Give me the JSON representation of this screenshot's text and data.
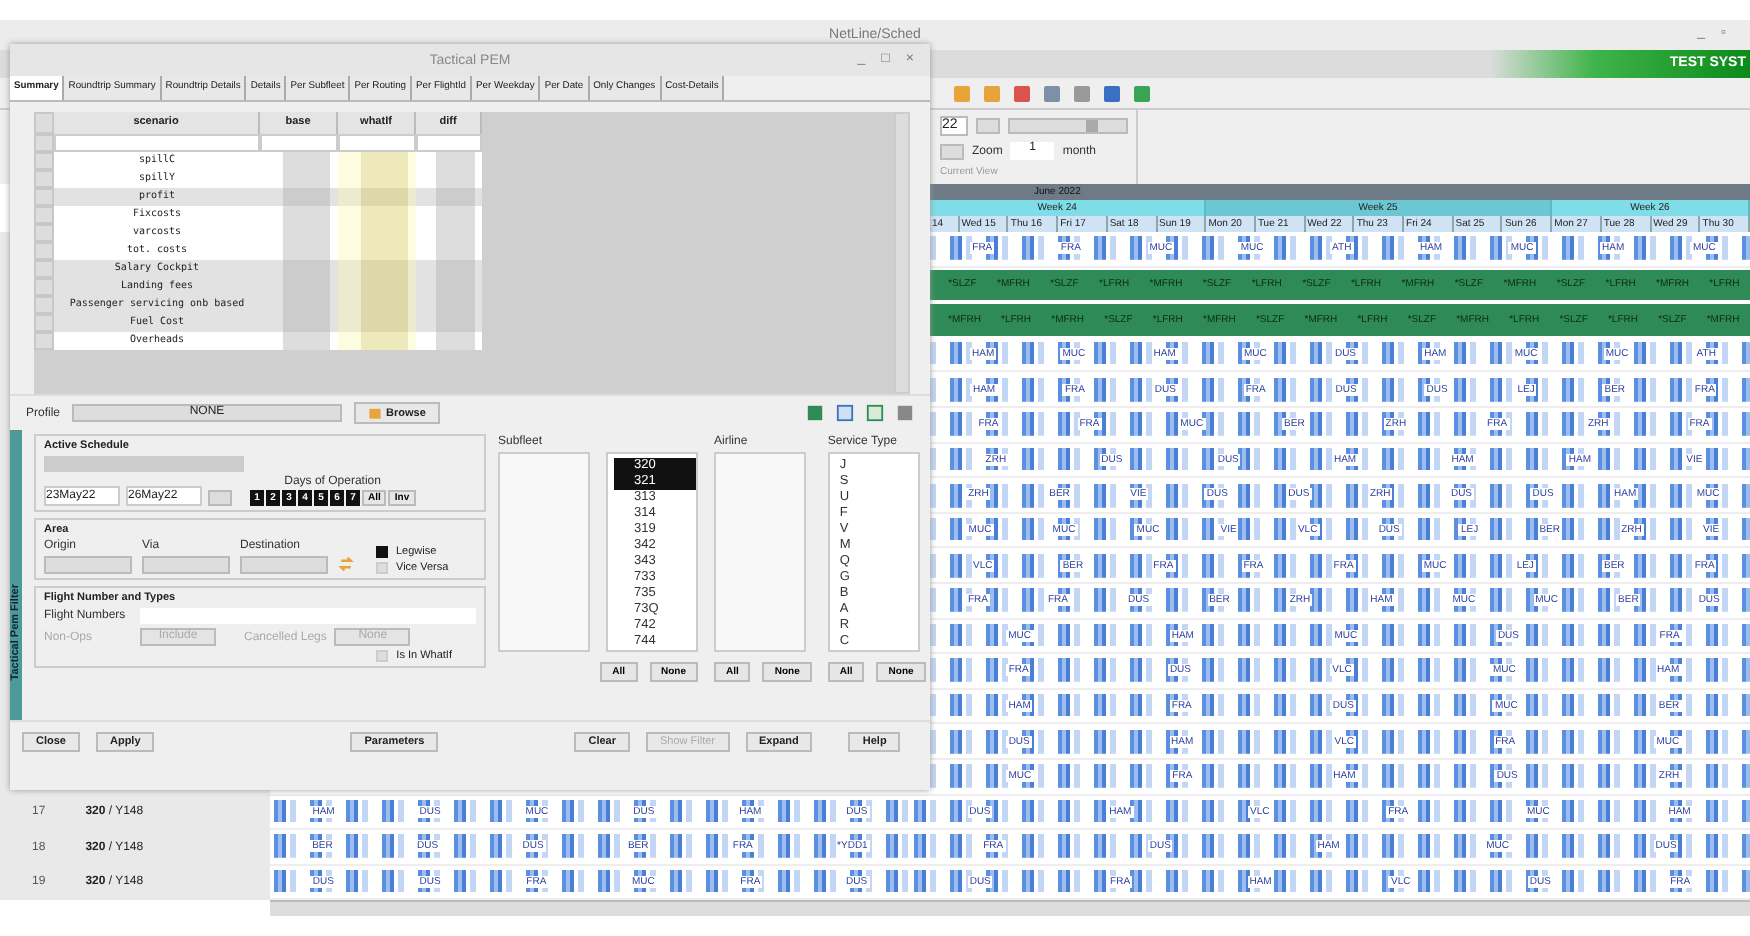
{
  "main_window": {
    "title": "NetLine/Sched",
    "window_buttons": [
      "_",
      "▫"
    ],
    "slider": {
      "level": 0.75
    },
    "banner": "TEST SYST",
    "date_field": "22",
    "zoom_label": "Zoom",
    "zoom_value": "1",
    "zoom_unit": "month",
    "view_label": "Current View"
  },
  "calendar": {
    "month": "June 2022",
    "weeks": [
      {
        "label": "Week 24",
        "days": [
          "14",
          "Wed 15",
          "Thu 16",
          "Fri 17",
          "Sat 18",
          "Sun 19"
        ]
      },
      {
        "label": "Week 25",
        "days": [
          "Mon 20",
          "Tue 21",
          "Wed 22",
          "Thu 23",
          "Fri 24",
          "Sat 25",
          "Sun 26"
        ]
      },
      {
        "label": "Week 26",
        "days": [
          "Mon 27",
          "Tue 28",
          "Wed 29",
          "Thu 30"
        ]
      }
    ]
  },
  "rows": [
    {
      "kind": "flights",
      "labels": [
        "FRA",
        "FRA",
        "MUC",
        "MUC",
        "ATH",
        "HAM",
        "MUC",
        "HAM",
        "MUC"
      ]
    },
    {
      "kind": "block",
      "labels": [
        "*SLZF",
        "*MFRH",
        "*SLZF",
        "*LFRH",
        "*MFRH",
        "*SLZF",
        "*LFRH",
        "*SLZF",
        "*LFRH",
        "*MFRH",
        "*SLZF",
        "*MFRH",
        "*SLZF",
        "*LFRH",
        "*MFRH",
        "*LFRH"
      ]
    },
    {
      "kind": "block",
      "labels": [
        "*MFRH",
        "*LFRH",
        "*MFRH",
        "*SLZF",
        "*LFRH",
        "*MFRH",
        "*SLZF",
        "*MFRH",
        "*LFRH",
        "*SLZF",
        "*MFRH",
        "*LFRH",
        "*SLZF",
        "*LFRH",
        "*SLZF",
        "*MFRH"
      ]
    },
    {
      "kind": "flights",
      "labels": [
        "HAM",
        "MUC",
        "HAM",
        "MUC",
        "DUS",
        "HAM",
        "MUC",
        "MUC",
        "ATH"
      ]
    },
    {
      "kind": "flights",
      "labels": [
        "HAM",
        "FRA",
        "DUS",
        "FRA",
        "DUS",
        "DUS",
        "LEJ",
        "BER",
        "FRA"
      ]
    },
    {
      "kind": "flights",
      "labels": [
        "FRA",
        "FRA",
        "MUC",
        "BER",
        "ZRH",
        "FRA",
        "ZRH",
        "FRA"
      ]
    },
    {
      "kind": "flights",
      "labels": [
        "ZRH",
        "DUS",
        "DUS",
        "HAM",
        "HAM",
        "HAM",
        "VIE"
      ]
    },
    {
      "kind": "flights",
      "labels": [
        "ZRH",
        "BER",
        "VIE",
        "DUS",
        "DUS",
        "ZRH",
        "DUS",
        "DUS",
        "HAM",
        "MUC"
      ]
    },
    {
      "kind": "flights",
      "labels": [
        "MUC",
        "MUC",
        "MUC",
        "VIE",
        "VLC",
        "DUS",
        "LEJ",
        "BER",
        "ZRH",
        "VIE"
      ]
    },
    {
      "kind": "flights",
      "labels": [
        "VLC",
        "BER",
        "FRA",
        "FRA",
        "FRA",
        "MUC",
        "LEJ",
        "BER",
        "FRA"
      ]
    },
    {
      "kind": "flights",
      "labels": [
        "FRA",
        "FRA",
        "DUS",
        "BER",
        "ZRH",
        "HAM",
        "MUC",
        "MUC",
        "BER",
        "DUS"
      ]
    },
    {
      "kind": "flights",
      "labels": [
        "MUC",
        "HAM",
        "MUC",
        "DUS",
        "FRA"
      ]
    },
    {
      "kind": "flights",
      "labels": [
        "FRA",
        "DUS",
        "VLC",
        "MUC",
        "HAM"
      ]
    },
    {
      "kind": "flights",
      "labels": [
        "HAM",
        "FRA",
        "DUS",
        "MUC",
        "BER"
      ]
    },
    {
      "kind": "flights",
      "labels": [
        "DUS",
        "HAM",
        "VLC",
        "FRA",
        "MUC"
      ]
    },
    {
      "kind": "flights",
      "labels": [
        "MUC",
        "FRA",
        "HAM",
        "DUS",
        "ZRH"
      ]
    },
    {
      "kind": "flights",
      "number": "17",
      "type": "**320** / Y148",
      "labels_early": [
        "HAM",
        "DUS",
        "MUC",
        "DUS",
        "HAM",
        "DUS"
      ],
      "labels": [
        "DUS",
        "HAM",
        "VLC",
        "FRA",
        "MUC",
        "HAM"
      ]
    },
    {
      "kind": "flights",
      "number": "18",
      "type": "**320** / Y148",
      "labels_early": [
        "BER",
        "DUS",
        "DUS",
        "BER",
        "FRA",
        "*YDD1"
      ],
      "labels": [
        "FRA",
        "DUS",
        "HAM",
        "MUC",
        "DUS"
      ]
    },
    {
      "kind": "flights",
      "number": "19",
      "type": "**320** / Y148",
      "labels_early": [
        "DUS",
        "DUS",
        "FRA",
        "MUC",
        "FRA",
        "DUS"
      ],
      "labels": [
        "DUS",
        "FRA",
        "HAM",
        "VLC",
        "DUS",
        "FRA"
      ]
    }
  ],
  "dialog": {
    "title": "Tactical PEM",
    "window_buttons": [
      "_",
      "□",
      "×"
    ],
    "tabs": [
      {
        "label": "Summary",
        "selected": true
      },
      {
        "label": "Roundtrip Summary",
        "selected": false
      },
      {
        "label": "Roundtrip Details",
        "selected": false
      },
      {
        "label": "Details",
        "selected": false
      },
      {
        "label": "Per Subfleet",
        "selected": false
      },
      {
        "label": "Per Routing",
        "selected": false
      },
      {
        "label": "Per FlightId",
        "selected": false
      },
      {
        "label": "Per Weekday",
        "selected": false
      },
      {
        "label": "Per Date",
        "selected": false
      },
      {
        "label": "Only Changes",
        "selected": false
      },
      {
        "label": "Cost-Details",
        "selected": false
      }
    ],
    "table": {
      "columns": [
        "scenario",
        "base",
        "whatIf",
        "diff"
      ],
      "rows": [
        {
          "name": "spillC",
          "shaded": false
        },
        {
          "name": "spillY",
          "shaded": false
        },
        {
          "name": "profit",
          "shaded": true
        },
        {
          "name": "Fixcosts",
          "shaded": false
        },
        {
          "name": "varcosts",
          "shaded": false
        },
        {
          "name": "tot. costs",
          "shaded": false
        },
        {
          "name": "Salary Cockpit",
          "shaded": true
        },
        {
          "name": "Landing fees",
          "shaded": true
        },
        {
          "name": "Passenger servicing  onb based",
          "shaded": true
        },
        {
          "name": "Fuel Cost",
          "shaded": true
        },
        {
          "name": "Overheads",
          "shaded": false
        }
      ]
    },
    "profile": {
      "label": "Profile",
      "value": "NONE",
      "browse": "Browse"
    },
    "filter_tab": "Tactical Pem Filter",
    "active_schedule": {
      "title": "Active Schedule",
      "from": "23May22",
      "to": "26May22",
      "days_title": "Days of Operation",
      "days": [
        {
          "label": "1",
          "checked": true
        },
        {
          "label": "2",
          "checked": true
        },
        {
          "label": "3",
          "checked": true
        },
        {
          "label": "4",
          "checked": true
        },
        {
          "label": "5",
          "checked": true
        },
        {
          "label": "6",
          "checked": true
        },
        {
          "label": "7",
          "checked": true
        }
      ],
      "all": "All",
      "inv": "Inv"
    },
    "area": {
      "title": "Area",
      "origin": "Origin",
      "via": "Via",
      "destination": "Destination",
      "legwise": {
        "label": "Legwise",
        "checked": true
      },
      "vice_versa": {
        "label": "Vice Versa",
        "checked": false
      }
    },
    "flight": {
      "title": "Flight Number and Types",
      "numbers_label": "Flight Numbers",
      "non_ops_label": "Non-Ops",
      "non_ops_value": "Include",
      "cancelled_label": "Cancelled Legs",
      "cancelled_value": "None",
      "in_whatif": {
        "label": "Is In WhatIf",
        "checked": false
      }
    },
    "subfleet": {
      "title": "Subfleet",
      "items": [
        {
          "label": "320",
          "selected": true
        },
        {
          "label": "321",
          "selected": true
        },
        {
          "label": "313",
          "selected": false
        },
        {
          "label": "314",
          "selected": false
        },
        {
          "label": "319",
          "selected": false
        },
        {
          "label": "342",
          "selected": false
        },
        {
          "label": "343",
          "selected": false
        },
        {
          "label": "733",
          "selected": false
        },
        {
          "label": "735",
          "selected": false
        },
        {
          "label": "73Q",
          "selected": false
        },
        {
          "label": "742",
          "selected": false
        },
        {
          "label": "744",
          "selected": false
        }
      ]
    },
    "airline": {
      "title": "Airline"
    },
    "service": {
      "title": "Service Type",
      "items": [
        "J",
        "S",
        "U",
        "F",
        "V",
        "M",
        "Q",
        "G",
        "B",
        "A",
        "R",
        "C"
      ]
    },
    "list_buttons": [
      [
        "All",
        "None"
      ],
      [
        "All",
        "None"
      ],
      [
        "All",
        "None"
      ]
    ],
    "buttons": [
      {
        "label": "Close",
        "disabled": false
      },
      {
        "label": "Apply",
        "disabled": false
      },
      {
        "label": "Parameters",
        "disabled": false
      },
      {
        "label": "Clear",
        "disabled": false
      },
      {
        "label": "Show Filter",
        "disabled": true
      },
      {
        "label": "Expand",
        "disabled": false
      },
      {
        "label": "Help",
        "disabled": false
      }
    ]
  }
}
